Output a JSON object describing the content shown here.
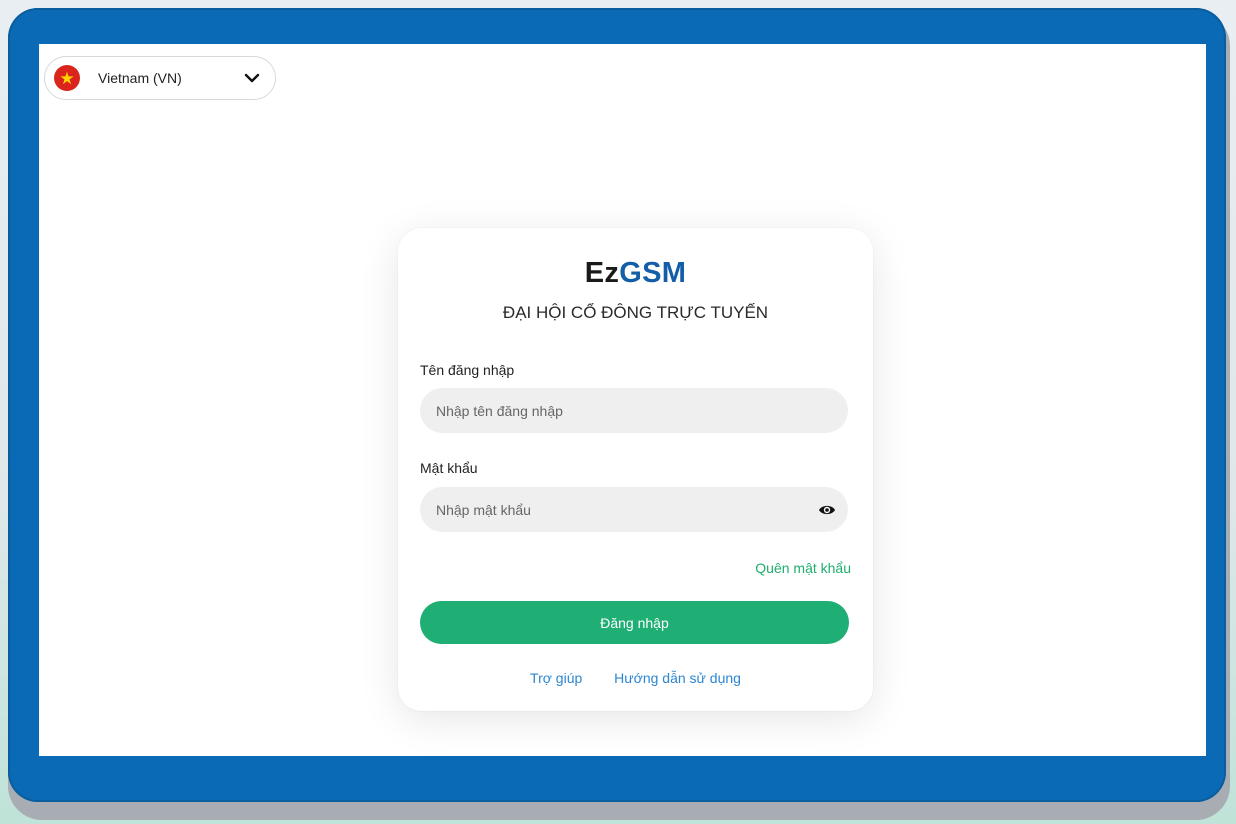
{
  "language_selector": {
    "label": "Vietnam (VN)",
    "flag_icon": "vietnam-flag-icon",
    "chevron_icon": "chevron-down-icon"
  },
  "brand": {
    "part1": "Ez",
    "part2": "GSM",
    "subtitle": "ĐẠI HỘI CỔ ĐÔNG TRỰC TUYẾN"
  },
  "form": {
    "username_label": "Tên đăng nhập",
    "username_placeholder": "Nhập tên đăng nhập",
    "password_label": "Mật khẩu",
    "password_placeholder": "Nhập mật khẩu",
    "forgot_password": "Quên mật khẩu",
    "login_button": "Đăng nhập"
  },
  "footer_links": {
    "help": "Trợ giúp",
    "guide": "Hướng dẫn sử dụng"
  },
  "colors": {
    "frame": "#0a6ab5",
    "brand_gsm": "#135ea8",
    "primary_green": "#1fae74",
    "link_blue": "#2c86d1",
    "flag_red": "#da251d"
  }
}
